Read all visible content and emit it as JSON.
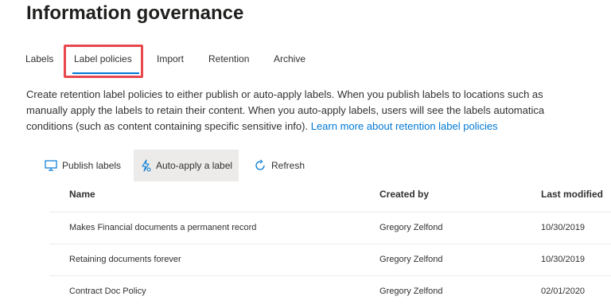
{
  "page": {
    "title": "Information governance"
  },
  "tabs": [
    {
      "label": "Labels"
    },
    {
      "label": "Label policies"
    },
    {
      "label": "Import"
    },
    {
      "label": "Retention"
    },
    {
      "label": "Archive"
    }
  ],
  "description": {
    "line1": "Create retention label policies to either publish or auto-apply labels. When you publish labels to locations such as",
    "line2": "manually apply the labels to retain their content. When you auto-apply labels, users will see the labels automatica",
    "line3": "conditions (such as content containing specific sensitive info).",
    "link": "Learn more about retention label policies"
  },
  "toolbar": {
    "publish_label": "Publish labels",
    "auto_apply_label": "Auto-apply a label",
    "refresh_label": "Refresh"
  },
  "table": {
    "headers": {
      "name": "Name",
      "created_by": "Created by",
      "last_modified": "Last modified"
    },
    "rows": [
      {
        "name": "Makes Financial documents a permanent record",
        "created_by": "Gregory Zelfond",
        "last_modified": "10/30/2019"
      },
      {
        "name": "Retaining documents forever",
        "created_by": "Gregory Zelfond",
        "last_modified": "10/30/2019"
      },
      {
        "name": "Contract Doc Policy",
        "created_by": "Gregory Zelfond",
        "last_modified": "02/01/2020"
      }
    ]
  },
  "colors": {
    "accent": "#0078d4",
    "highlight": "#e8474c",
    "hover": "#edebe9"
  },
  "icons": {
    "publish": "monitor-icon",
    "auto_apply": "auto-apply-icon",
    "refresh": "refresh-icon"
  }
}
